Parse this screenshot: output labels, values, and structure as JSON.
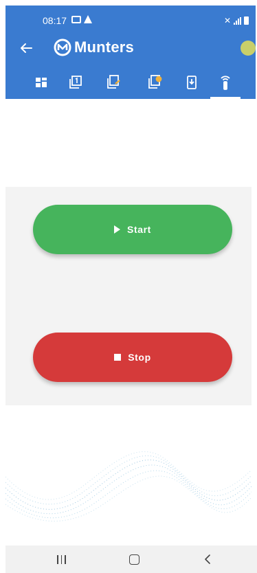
{
  "status_bar": {
    "time": "08:17"
  },
  "app_bar": {
    "brand": "Munters",
    "icons": [
      "back-arrow-icon",
      "munters-logo-icon",
      "connection-status-dot"
    ],
    "colors": {
      "bar": "#3a7bd0",
      "status_dot": "#c8cf6a"
    }
  },
  "tabs": [
    {
      "icon": "dashboard-grid-icon"
    },
    {
      "icon": "page-one-icon"
    },
    {
      "icon": "document-edit-icon"
    },
    {
      "icon": "document-settings-icon"
    },
    {
      "icon": "mobile-download-icon"
    },
    {
      "icon": "remote-control-icon",
      "selected": true
    }
  ],
  "controls": {
    "start_label": "Start",
    "stop_label": "Stop",
    "colors": {
      "start": "#46b45c",
      "stop": "#d53a3a"
    }
  },
  "system_nav": {
    "icons": [
      "recents-icon",
      "home-icon",
      "back-icon"
    ]
  }
}
